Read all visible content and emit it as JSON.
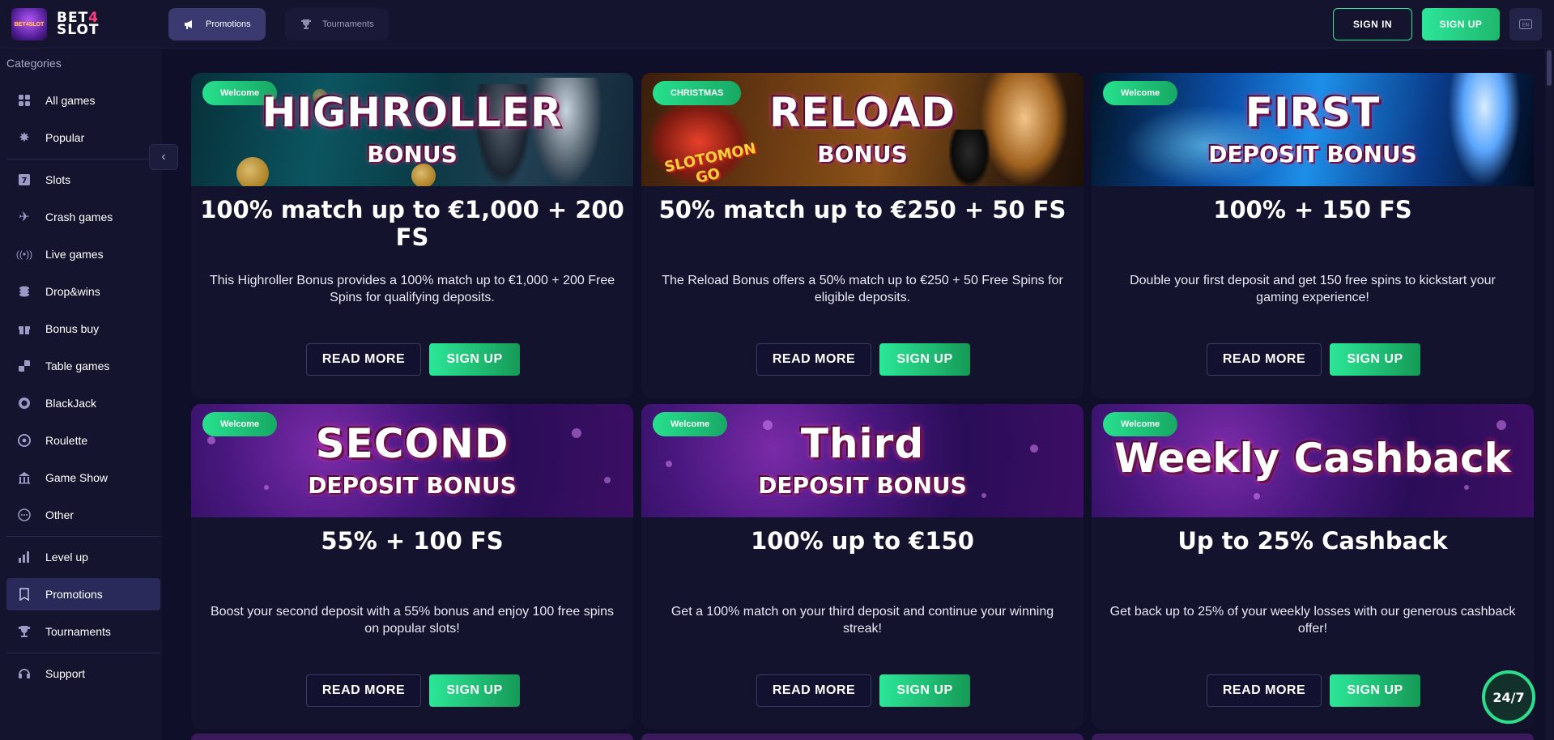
{
  "brand": {
    "logo_text_1": "BET",
    "logo_four": "4",
    "logo_text_2": "SLOT",
    "badge_text": "BET4SLOT"
  },
  "header": {
    "tabs": [
      {
        "label": "Promotions",
        "icon": "megaphone-icon",
        "active": true
      },
      {
        "label": "Tournaments",
        "icon": "trophy-icon",
        "active": false
      }
    ],
    "sign_in": "SIGN IN",
    "sign_up": "SIGN UP"
  },
  "sidebar": {
    "title": "Categories",
    "items": [
      {
        "label": "All games",
        "icon": "grid-icon"
      },
      {
        "label": "Popular",
        "icon": "star-burst-icon"
      },
      {
        "label": "Slots",
        "icon": "slot-seven-icon"
      },
      {
        "label": "Crash games",
        "icon": "plane-icon"
      },
      {
        "label": "Live games",
        "icon": "live-signal-icon"
      },
      {
        "label": "Drop&wins",
        "icon": "coins-icon"
      },
      {
        "label": "Bonus buy",
        "icon": "gift-icon"
      },
      {
        "label": "Table games",
        "icon": "checker-icon"
      },
      {
        "label": "BlackJack",
        "icon": "chip-icon"
      },
      {
        "label": "Roulette",
        "icon": "roulette-icon"
      },
      {
        "label": "Game Show",
        "icon": "stage-icon"
      },
      {
        "label": "Other",
        "icon": "ellipsis-icon"
      },
      {
        "label": "Level up",
        "icon": "level-bars-icon"
      },
      {
        "label": "Promotions",
        "icon": "bookmark-icon"
      },
      {
        "label": "Tournaments",
        "icon": "trophy-icon"
      },
      {
        "label": "Support",
        "icon": "headset-icon"
      }
    ]
  },
  "promos": [
    {
      "badge": "Welcome",
      "banner_l1": "HIGHROLLER",
      "banner_l2": "BONUS",
      "headline": "100% match up to €1,000 + 200 FS",
      "desc": "This Highroller Bonus provides a 100% match up to €1,000 + 200 Free Spins for qualifying deposits.",
      "read_more": "READ MORE",
      "sign_up": "SIGN UP"
    },
    {
      "badge": "CHRISTMAS",
      "banner_l1": "RELOAD",
      "banner_l2": "BONUS",
      "banner_extra": "SLOTOMON GO",
      "headline": "50% match up to €250 + 50 FS",
      "desc": "The Reload Bonus offers a 50% match up to €250 + 50 Free Spins for eligible deposits.",
      "read_more": "READ MORE",
      "sign_up": "SIGN UP"
    },
    {
      "badge": "Welcome",
      "banner_l1": "FIRST",
      "banner_l2": "DEPOSIT BONUS",
      "headline": "100% + 150 FS",
      "desc": "Double your first deposit and get 150 free spins to kickstart your gaming experience!",
      "read_more": "READ MORE",
      "sign_up": "SIGN UP"
    },
    {
      "badge": "Welcome",
      "banner_l1": "SECOND",
      "banner_l2": "DEPOSIT BONUS",
      "headline": "55% + 100 FS",
      "desc": "Boost your second deposit with a 55% bonus and enjoy 100 free spins on popular slots!",
      "read_more": "READ MORE",
      "sign_up": "SIGN UP"
    },
    {
      "badge": "Welcome",
      "banner_l1": "Third",
      "banner_l2": "DEPOSIT BONUS",
      "headline": "100% up to €150",
      "desc": "Get a 100% match on your third deposit and continue your winning streak!",
      "read_more": "READ MORE",
      "sign_up": "SIGN UP"
    },
    {
      "badge": "Welcome",
      "banner_l1": "Weekly Cashback",
      "banner_l2": "",
      "headline": "Up to 25% Cashback",
      "desc": "Get back up to 25% of your weekly losses with our generous cashback offer!",
      "read_more": "READ MORE",
      "sign_up": "SIGN UP"
    }
  ],
  "chat": {
    "label": "24/7"
  },
  "colors": {
    "accent": "#2de59a",
    "bg": "#0f0f2a",
    "panel": "#14142e",
    "brand_pink": "#ff3d7f"
  }
}
